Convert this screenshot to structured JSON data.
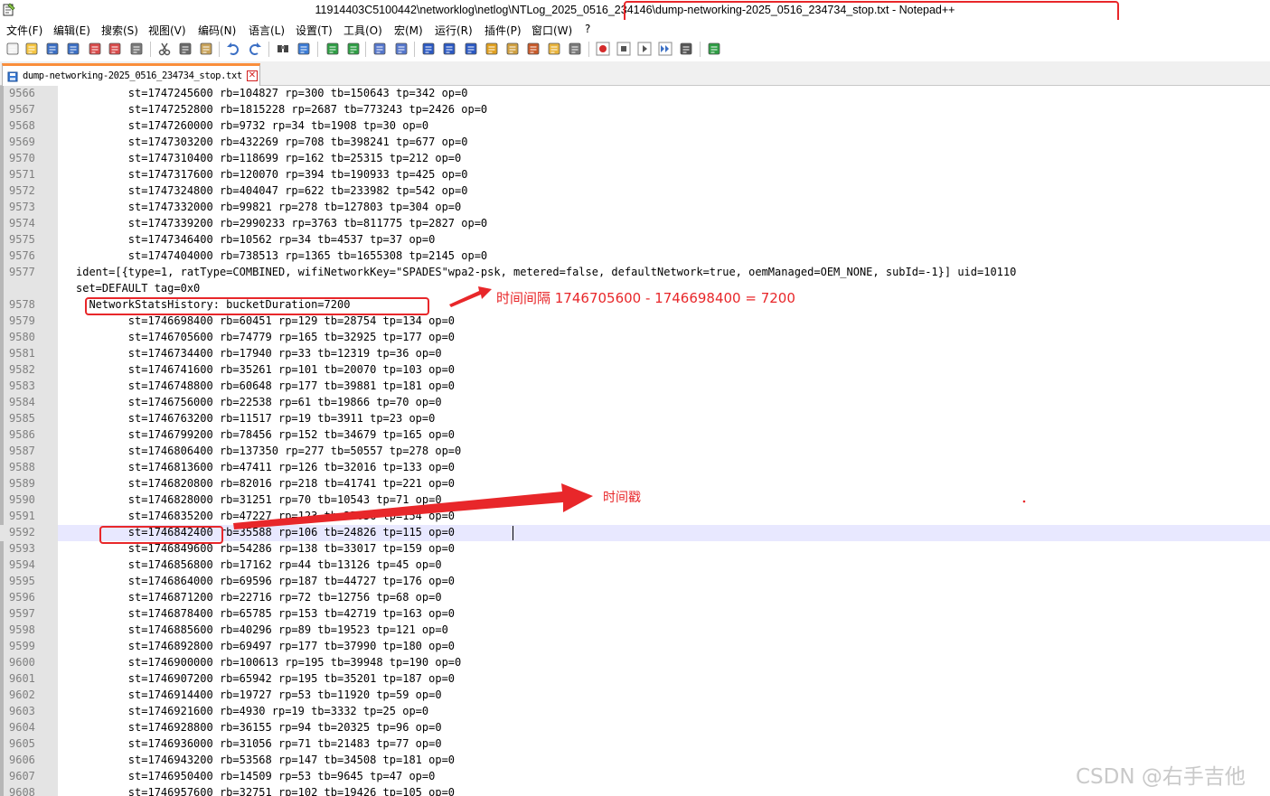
{
  "window": {
    "title": "11914403C5100442\\networklog\\netlog\\NTLog_2025_0516_234146\\dump-networking-2025_0516_234734_stop.txt - Notepad++"
  },
  "menu": [
    "文件(F)",
    "编辑(E)",
    "搜索(S)",
    "视图(V)",
    "编码(N)",
    "语言(L)",
    "设置(T)",
    "工具(O)",
    "宏(M)",
    "运行(R)",
    "插件(P)",
    "窗口(W)",
    "?"
  ],
  "toolbar": {
    "buttons": [
      "new-file",
      "open-file",
      "save",
      "save-all",
      "close",
      "close-all",
      "print",
      "cut",
      "copy",
      "paste",
      "undo",
      "redo",
      "find",
      "replace",
      "zoom-in",
      "zoom-out",
      "sync-vertical",
      "sync-horizontal",
      "word-wrap",
      "show-all-chars",
      "indent-guide",
      "user-defined-language",
      "document-map",
      "function-list",
      "folder-as-workspace",
      "monitoring",
      "record-macro",
      "stop-record",
      "play-macro",
      "run-macro-multiple",
      "save-macro",
      "plugin-admin"
    ]
  },
  "tab": {
    "label": "dump-networking-2025_0516_234734_stop.txt",
    "close": "✕"
  },
  "editor": {
    "current_line": "9592",
    "lines": [
      {
        "n": "9566",
        "text": "        st=1747245600 rb=104827 rp=300 tb=150643 tp=342 op=0"
      },
      {
        "n": "9567",
        "text": "        st=1747252800 rb=1815228 rp=2687 tb=773243 tp=2426 op=0"
      },
      {
        "n": "9568",
        "text": "        st=1747260000 rb=9732 rp=34 tb=1908 tp=30 op=0"
      },
      {
        "n": "9569",
        "text": "        st=1747303200 rb=432269 rp=708 tb=398241 tp=677 op=0"
      },
      {
        "n": "9570",
        "text": "        st=1747310400 rb=118699 rp=162 tb=25315 tp=212 op=0"
      },
      {
        "n": "9571",
        "text": "        st=1747317600 rb=120070 rp=394 tb=190933 tp=425 op=0"
      },
      {
        "n": "9572",
        "text": "        st=1747324800 rb=404047 rp=622 tb=233982 tp=542 op=0"
      },
      {
        "n": "9573",
        "text": "        st=1747332000 rb=99821 rp=278 tb=127803 tp=304 op=0"
      },
      {
        "n": "9574",
        "text": "        st=1747339200 rb=2990233 rp=3763 tb=811775 tp=2827 op=0"
      },
      {
        "n": "9575",
        "text": "        st=1747346400 rb=10562 rp=34 tb=4537 tp=37 op=0"
      },
      {
        "n": "9576",
        "text": "        st=1747404000 rb=738513 rp=1365 tb=1655308 tp=2145 op=0"
      },
      {
        "n": "9577",
        "text": "ident=[{type=1, ratType=COMBINED, wifiNetworkKey=\"SPADES\"wpa2-psk, metered=false, defaultNetwork=true, oemManaged=OEM_NONE, subId=-1}] uid=10110"
      },
      {
        "n": "",
        "text": "set=DEFAULT tag=0x0"
      },
      {
        "n": "9578",
        "text": "  NetworkStatsHistory: bucketDuration=7200"
      },
      {
        "n": "9579",
        "text": "        st=1746698400 rb=60451 rp=129 tb=28754 tp=134 op=0"
      },
      {
        "n": "9580",
        "text": "        st=1746705600 rb=74779 rp=165 tb=32925 tp=177 op=0"
      },
      {
        "n": "9581",
        "text": "        st=1746734400 rb=17940 rp=33 tb=12319 tp=36 op=0"
      },
      {
        "n": "9582",
        "text": "        st=1746741600 rb=35261 rp=101 tb=20070 tp=103 op=0"
      },
      {
        "n": "9583",
        "text": "        st=1746748800 rb=60648 rp=177 tb=39881 tp=181 op=0"
      },
      {
        "n": "9584",
        "text": "        st=1746756000 rb=22538 rp=61 tb=19866 tp=70 op=0"
      },
      {
        "n": "9585",
        "text": "        st=1746763200 rb=11517 rp=19 tb=3911 tp=23 op=0"
      },
      {
        "n": "9586",
        "text": "        st=1746799200 rb=78456 rp=152 tb=34679 tp=165 op=0"
      },
      {
        "n": "9587",
        "text": "        st=1746806400 rb=137350 rp=277 tb=50557 tp=278 op=0"
      },
      {
        "n": "9588",
        "text": "        st=1746813600 rb=47411 rp=126 tb=32016 tp=133 op=0"
      },
      {
        "n": "9589",
        "text": "        st=1746820800 rb=82016 rp=218 tb=41741 tp=221 op=0"
      },
      {
        "n": "9590",
        "text": "        st=1746828000 rb=31251 rp=70 tb=10543 tp=71 op=0"
      },
      {
        "n": "9591",
        "text": "        st=1746835200 rb=47227 rp=123 tb=25636 tp=154 op=0"
      },
      {
        "n": "9592",
        "text": "        st=1746842400 rb=35588 rp=106 tb=24826 tp=115 op=0"
      },
      {
        "n": "9593",
        "text": "        st=1746849600 rb=54286 rp=138 tb=33017 tp=159 op=0"
      },
      {
        "n": "9594",
        "text": "        st=1746856800 rb=17162 rp=44 tb=13126 tp=45 op=0"
      },
      {
        "n": "9595",
        "text": "        st=1746864000 rb=69596 rp=187 tb=44727 tp=176 op=0"
      },
      {
        "n": "9596",
        "text": "        st=1746871200 rb=22716 rp=72 tb=12756 tp=68 op=0"
      },
      {
        "n": "9597",
        "text": "        st=1746878400 rb=65785 rp=153 tb=42719 tp=163 op=0"
      },
      {
        "n": "9598",
        "text": "        st=1746885600 rb=40296 rp=89 tb=19523 tp=121 op=0"
      },
      {
        "n": "9599",
        "text": "        st=1746892800 rb=69497 rp=177 tb=37990 tp=180 op=0"
      },
      {
        "n": "9600",
        "text": "        st=1746900000 rb=100613 rp=195 tb=39948 tp=190 op=0"
      },
      {
        "n": "9601",
        "text": "        st=1746907200 rb=65942 rp=195 tb=35201 tp=187 op=0"
      },
      {
        "n": "9602",
        "text": "        st=1746914400 rb=19727 rp=53 tb=11920 tp=59 op=0"
      },
      {
        "n": "9603",
        "text": "        st=1746921600 rb=4930 rp=19 tb=3332 tp=25 op=0"
      },
      {
        "n": "9604",
        "text": "        st=1746928800 rb=36155 rp=94 tb=20325 tp=96 op=0"
      },
      {
        "n": "9605",
        "text": "        st=1746936000 rb=31056 rp=71 tb=21483 tp=77 op=0"
      },
      {
        "n": "9606",
        "text": "        st=1746943200 rb=53568 rp=147 tb=34508 tp=181 op=0"
      },
      {
        "n": "9607",
        "text": "        st=1746950400 rb=14509 rp=53 tb=9645 tp=47 op=0"
      },
      {
        "n": "9608",
        "text": "        st=1746957600 rb=32751 rp=102 tb=19426 tp=105 op=0"
      }
    ]
  },
  "annotations": {
    "interval_note": "时间间隔 1746705600 - 1746698400 = 7200",
    "timestamp_note": "时间戳"
  },
  "watermark": "CSDN @右手吉他",
  "colors": {
    "annotation": "#e8272a",
    "tab_accent": "#fa8e3c",
    "current_line": "#e8e8ff"
  }
}
